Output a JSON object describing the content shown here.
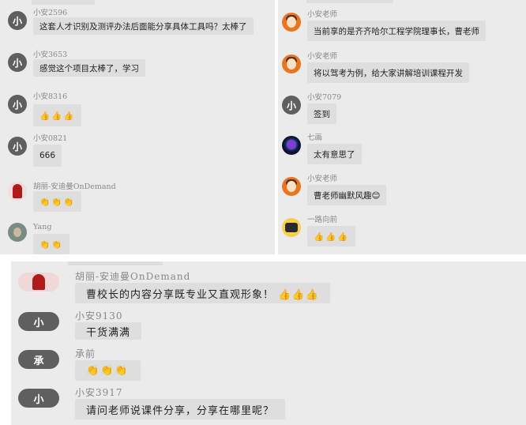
{
  "left_panel": {
    "messages": [
      {
        "avatar": "小",
        "name": "小安2596",
        "text": "这套人才识别及测评办法后面能分享具体工具吗？太棒了"
      },
      {
        "avatar": "小",
        "name": "小安3653",
        "text": "感觉这个项目太棒了，学习"
      },
      {
        "avatar": "小",
        "name": "小安8316",
        "text": "👍👍👍"
      },
      {
        "avatar": "小",
        "name": "小安0821",
        "text": "666"
      },
      {
        "avatar": "",
        "name": "胡丽-安迪曼OnDemand",
        "text": "👏👏👏"
      },
      {
        "avatar": "",
        "name": "Yang",
        "text": "👏👏"
      }
    ]
  },
  "right_panel": {
    "messages": [
      {
        "avatar": "",
        "name": "小安老师",
        "text": "当前享的是齐齐哈尔工程学院理事长，曹老师"
      },
      {
        "avatar": "",
        "name": "小安老师",
        "text": "将以驾考为例，给大家讲解培训课程开发"
      },
      {
        "avatar": "小",
        "name": "小安7079",
        "text": "签到"
      },
      {
        "avatar": "",
        "name": "七画",
        "text": "太有意思了"
      },
      {
        "avatar": "",
        "name": "小安老师",
        "text": "曹老师幽默风趣😊"
      },
      {
        "avatar": "",
        "name": "一路向前",
        "text": "👍👍👍"
      }
    ]
  },
  "bottom_panel": {
    "messages": [
      {
        "avatar": "",
        "name": "胡丽-安迪曼OnDemand",
        "text": "曹校长的内容分享既专业又直观形象！ 👍👍👍"
      },
      {
        "avatar": "小",
        "name": "小安9130",
        "text": "干货满满"
      },
      {
        "avatar": "承",
        "name": "承前",
        "text": "👏👏👏"
      },
      {
        "avatar": "小",
        "name": "小安3917",
        "text": "请问老师说课件分享，分享在哪里呢？"
      }
    ]
  },
  "colors": {
    "panel_bg": "#ebebeb",
    "bubble_bg": "#dedede",
    "avatar_grey": "#5f5f5f",
    "name_grey": "#888888"
  }
}
